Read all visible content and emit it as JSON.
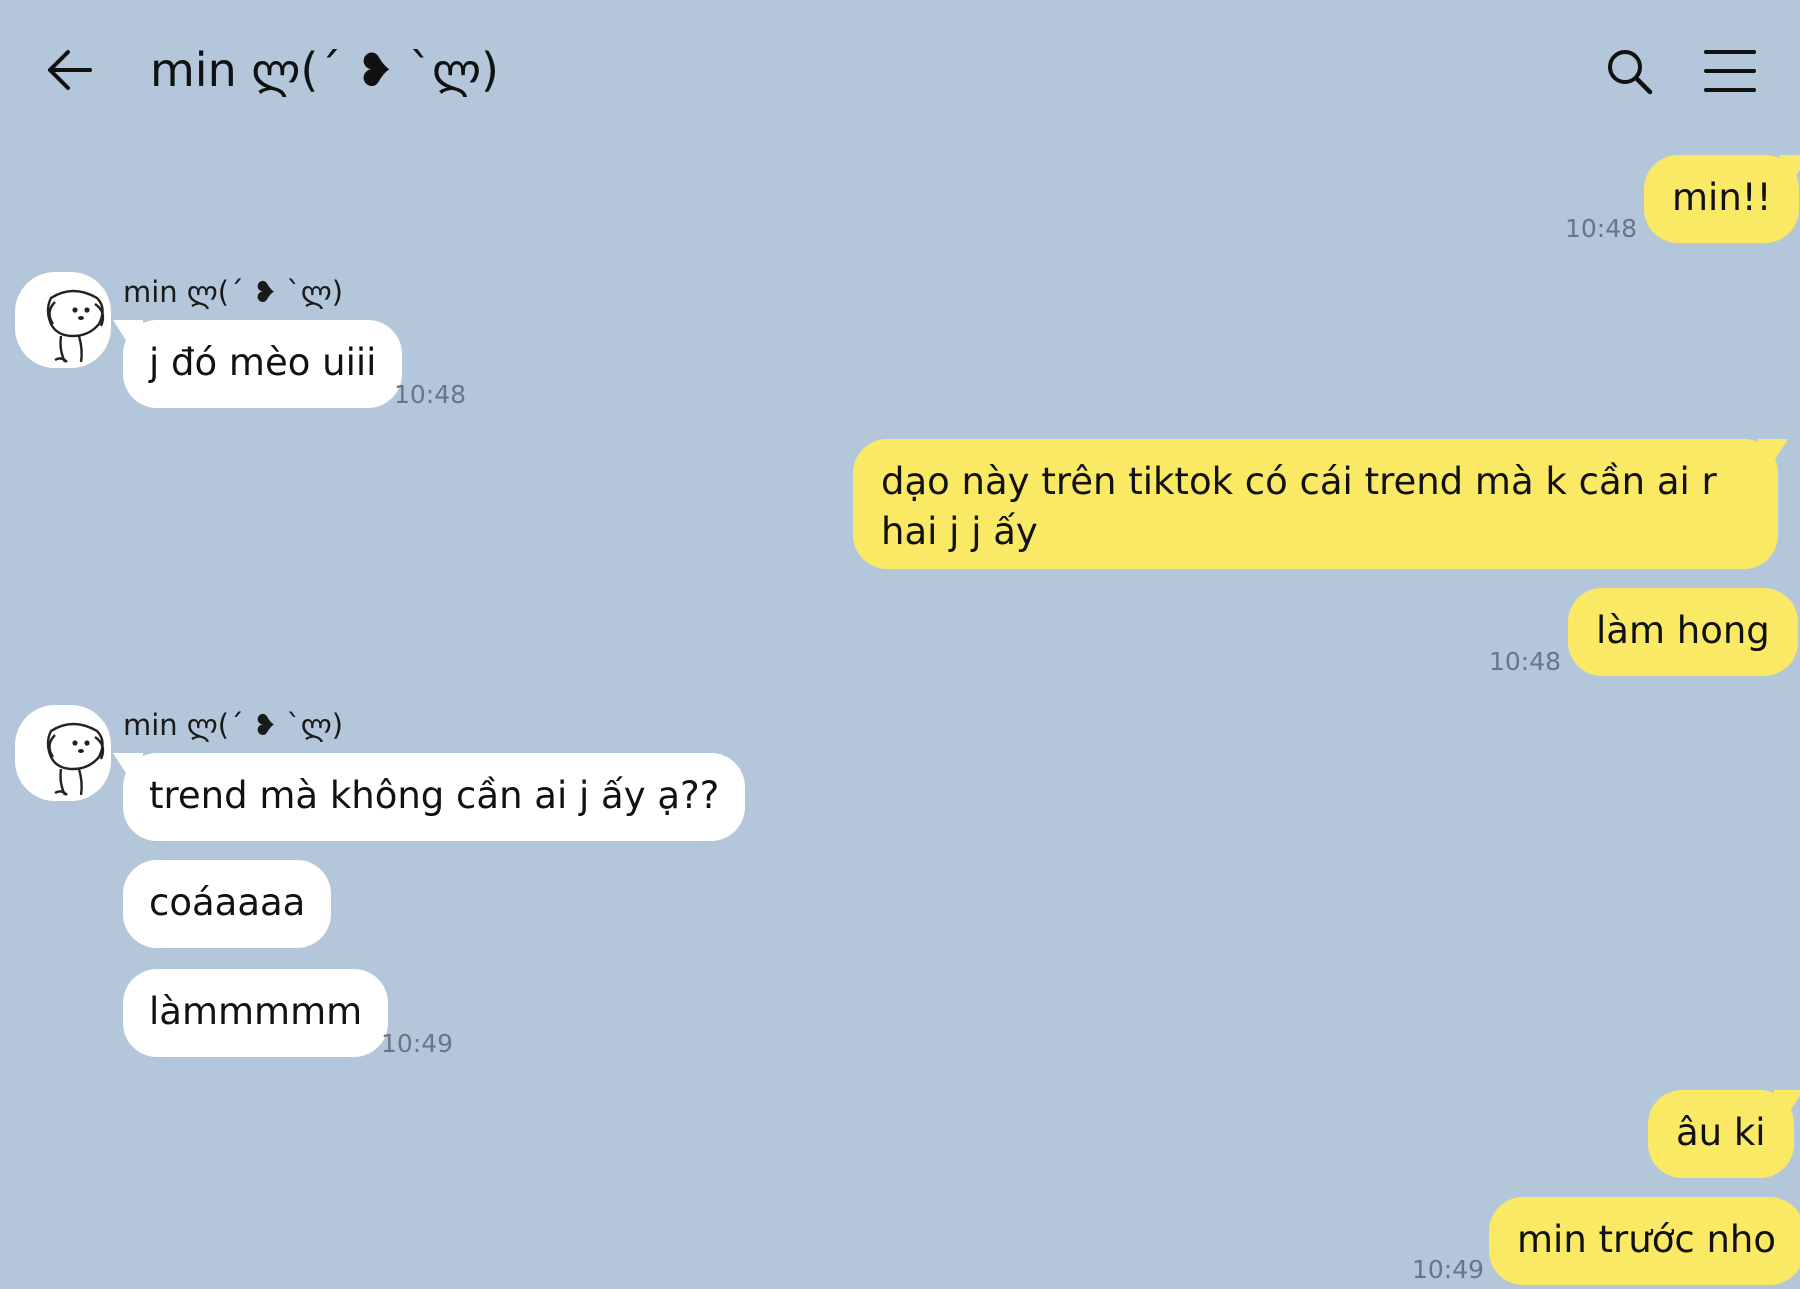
{
  "header": {
    "title": "min ლ(´ ❥ `ლ)"
  },
  "messages": {
    "m1": {
      "text": "min!!",
      "time": "10:48"
    },
    "m2": {
      "sender": "min ლ(´ ❥ `ლ)",
      "text": "j đó mèo uiii",
      "time": "10:48"
    },
    "m3": {
      "text": "dạo này trên tiktok có cái trend mà k cần ai r hai j j ấy"
    },
    "m4": {
      "text": "làm hong",
      "time": "10:48"
    },
    "m5": {
      "sender": "min ლ(´ ❥ `ლ)",
      "text": "trend mà không cần ai j ấy ạ??"
    },
    "m6": {
      "text": "coáaaaa"
    },
    "m7": {
      "text": "làmmmmm",
      "time": "10:49"
    },
    "m8": {
      "text": "âu ki"
    },
    "m9": {
      "text": "min trước nho",
      "time": "10:49"
    }
  },
  "icons": {
    "back": "arrow-left-icon",
    "search": "search-icon",
    "menu": "hamburger-menu-icon",
    "avatar": "dog-avatar-icon"
  },
  "colors": {
    "background": "#b4c6d9",
    "my_bubble": "#fae964",
    "their_bubble": "#ffffff",
    "timestamp": "#6a7683"
  }
}
